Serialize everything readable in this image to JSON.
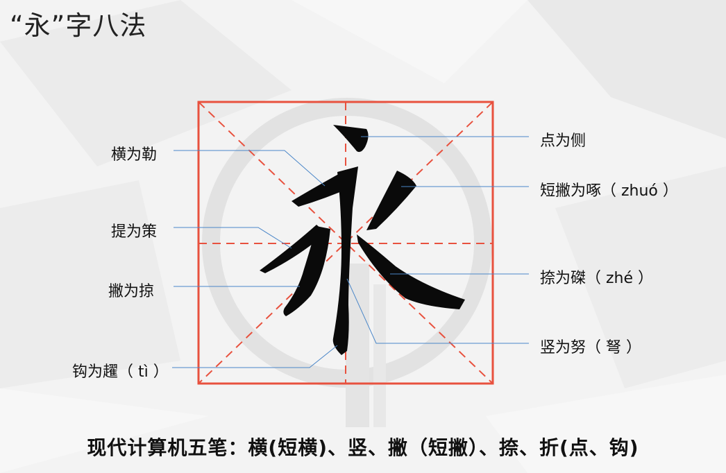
{
  "title": "“永”字八法",
  "labels": {
    "heng": "横为勒",
    "ti": "提为策",
    "pie": "撇为掠",
    "gou": "钩为趯（ tì ）",
    "dian": "点为侧",
    "duanpie": "短撇为啄（ zhuó ）",
    "na": "捺为磔（ zhé ）",
    "shu": "竖为努（ 弩 ）"
  },
  "footer": "现代计算机五笔：横(短横)、竖、撇（短撇）、捺、折(点、钩)",
  "colors": {
    "grid": "#e8513e",
    "leader": "#4a86c8",
    "ink": "#0a0a0a"
  }
}
